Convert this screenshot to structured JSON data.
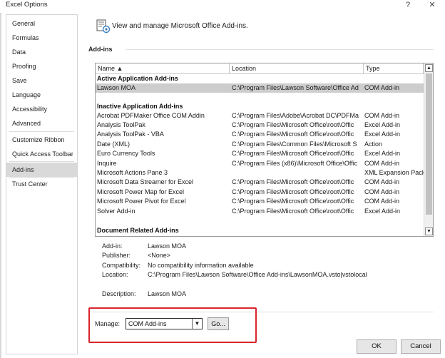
{
  "window": {
    "title": "Excel Options",
    "help_glyph": "?",
    "close_glyph": "✕"
  },
  "nav": {
    "items": [
      {
        "label": "General"
      },
      {
        "label": "Formulas"
      },
      {
        "label": "Data"
      },
      {
        "label": "Proofing"
      },
      {
        "label": "Save"
      },
      {
        "label": "Language"
      },
      {
        "label": "Accessibility"
      },
      {
        "label": "Advanced"
      },
      {
        "label": "Customize Ribbon"
      },
      {
        "label": "Quick Access Toolbar"
      },
      {
        "label": "Add-ins",
        "selected": true
      },
      {
        "label": "Trust Center"
      }
    ]
  },
  "header": {
    "text": "View and manage Microsoft Office Add-ins."
  },
  "section": {
    "title": "Add-ins"
  },
  "table": {
    "columns": [
      "Name ▲",
      "Location",
      "Type"
    ],
    "groups": [
      {
        "title": "Active Application Add-ins",
        "rows": [
          {
            "name": "Lawson MOA",
            "location": "C:\\Program Files\\Lawson Software\\Office Ad",
            "type": "COM Add-in",
            "selected": true
          }
        ]
      },
      {
        "title": "Inactive Application Add-ins",
        "rows": [
          {
            "name": "Acrobat PDFMaker Office COM Addin",
            "location": "C:\\Program Files\\Adobe\\Acrobat DC\\PDFMa",
            "type": "COM Add-in"
          },
          {
            "name": "Analysis ToolPak",
            "location": "C:\\Program Files\\Microsoft Office\\root\\Offic",
            "type": "Excel Add-in"
          },
          {
            "name": "Analysis ToolPak - VBA",
            "location": "C:\\Program Files\\Microsoft Office\\root\\Offic",
            "type": "Excel Add-in"
          },
          {
            "name": "Date (XML)",
            "location": "C:\\Program Files\\Common Files\\Microsoft S",
            "type": "Action"
          },
          {
            "name": "Euro Currency Tools",
            "location": "C:\\Program Files\\Microsoft Office\\root\\Offic",
            "type": "Excel Add-in"
          },
          {
            "name": "Inquire",
            "location": "C:\\Program Files (x86)\\Microsoft Office\\Offic",
            "type": "COM Add-in"
          },
          {
            "name": "Microsoft Actions Pane 3",
            "location": "",
            "type": "XML Expansion Pack"
          },
          {
            "name": "Microsoft Data Streamer for Excel",
            "location": "C:\\Program Files\\Microsoft Office\\root\\Offic",
            "type": "COM Add-in"
          },
          {
            "name": "Microsoft Power Map for Excel",
            "location": "C:\\Program Files\\Microsoft Office\\root\\Offic",
            "type": "COM Add-in"
          },
          {
            "name": "Microsoft Power Pivot for Excel",
            "location": "C:\\Program Files\\Microsoft Office\\root\\Offic",
            "type": "COM Add-in"
          },
          {
            "name": "Solver Add-in",
            "location": "C:\\Program Files\\Microsoft Office\\root\\Offic",
            "type": "Excel Add-in"
          }
        ]
      },
      {
        "title": "Document Related Add-ins",
        "rows": []
      }
    ]
  },
  "details": {
    "addin_label": "Add-in:",
    "addin_value": "Lawson MOA",
    "publisher_label": "Publisher:",
    "publisher_value": "<None>",
    "compat_label": "Compatibility:",
    "compat_value": "No compatibility information available",
    "location_label": "Location:",
    "location_value": "C:\\Program Files\\Lawson Software\\Office Add-ins\\LawsonMOA.vsto|vstolocal",
    "description_label": "Description:",
    "description_value": "Lawson MOA"
  },
  "manage": {
    "label": "Manage:",
    "selected": "COM Add-ins",
    "go_label": "Go..."
  },
  "footer": {
    "ok_label": "OK",
    "cancel_label": "Cancel"
  },
  "colors": {
    "highlight": "#d9242c",
    "selected_row": "#cdcdcd",
    "selected_nav": "#d9d9d9"
  }
}
